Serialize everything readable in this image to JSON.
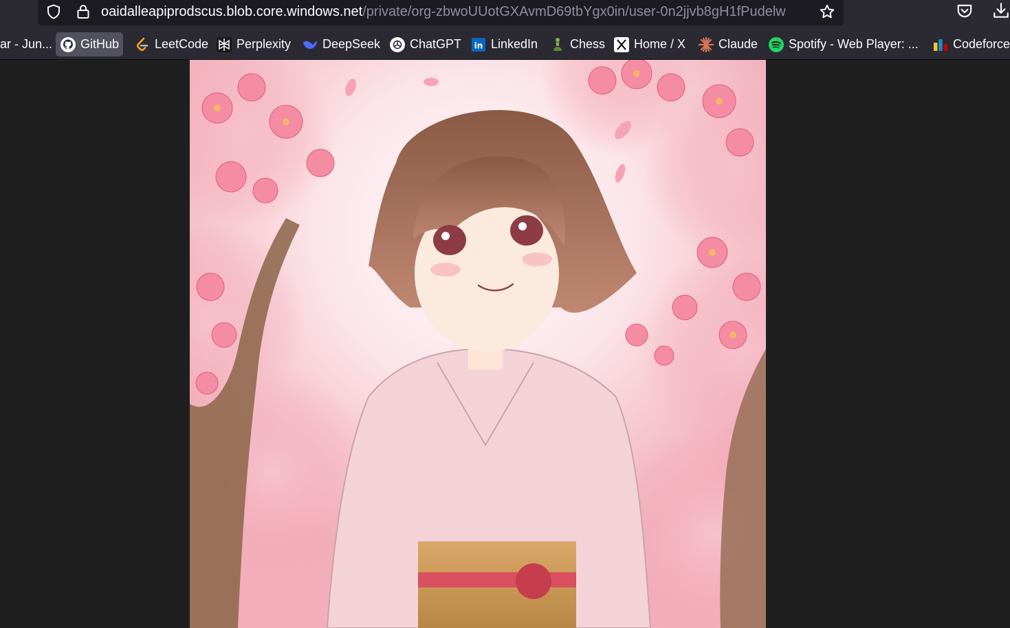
{
  "urlbar": {
    "domain": "oaidalleapiprodscus.blob.core.windows.net",
    "path": "/private/org-zbwoUUotGXAvmD69tbYgx0in/user-0n2jjvb8gH1fPudelw",
    "icons": [
      "shield-icon",
      "lock-icon",
      "star-icon"
    ]
  },
  "toolbar": {
    "icons": [
      "pocket-icon",
      "download-icon"
    ]
  },
  "bookmarks": [
    {
      "label": "ar - Jun...",
      "icon": "none"
    },
    {
      "label": "GitHub",
      "icon": "github-icon"
    },
    {
      "label": "LeetCode",
      "icon": "leetcode-icon"
    },
    {
      "label": "Perplexity",
      "icon": "perplexity-icon"
    },
    {
      "label": "DeepSeek",
      "icon": "deepseek-icon"
    },
    {
      "label": "ChatGPT",
      "icon": "chatgpt-icon"
    },
    {
      "label": "LinkedIn",
      "icon": "linkedin-icon"
    },
    {
      "label": "Chess",
      "icon": "chess-pawn-icon"
    },
    {
      "label": "Home / X",
      "icon": "x-icon"
    },
    {
      "label": "Claude",
      "icon": "claude-icon"
    },
    {
      "label": "Spotify - Web Player: ...",
      "icon": "spotify-icon"
    },
    {
      "label": "Codeforces",
      "icon": "codeforces-icon"
    }
  ],
  "colors": {
    "toolbar_bg": "#2b2a33",
    "urlbar_bg": "#1c1b22",
    "page_bg": "#1f1f1f",
    "active_bookmark_bg": "#52525e",
    "text": "#fbfbfe",
    "dim_text": "#8f8f9d"
  }
}
